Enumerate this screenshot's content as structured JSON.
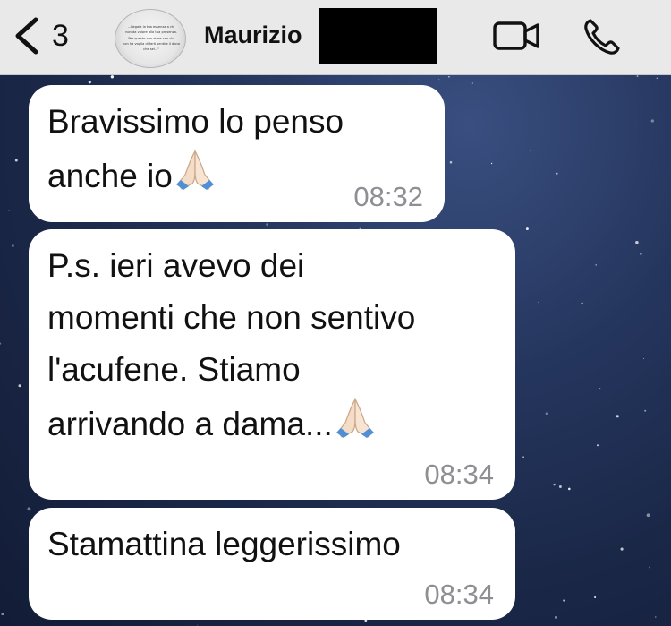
{
  "header": {
    "back_count": "3",
    "contact_name": "Maurizio",
    "avatar_caption": "...Regala la tua essenza a chi non da valore alla tua presenza. Per questo non stare con chi non ha voglia di farti sentire il dono che sei..."
  },
  "messages": [
    {
      "lines": [
        "Bravissimo lo penso",
        "anche io"
      ],
      "emoji": "folded-hands",
      "time": "08:32"
    },
    {
      "lines": [
        "P.s. ieri avevo dei",
        "momenti che non sentivo",
        "l'acufene. Stiamo",
        "arrivando a dama..."
      ],
      "emoji": "folded-hands",
      "time": "08:34"
    },
    {
      "lines": [
        "Stamattina leggerissimo"
      ],
      "emoji": "",
      "time": "08:34"
    }
  ],
  "colors": {
    "header_bg": "#e9e9e9",
    "bubble_bg": "#ffffff",
    "timestamp": "#8e8e93",
    "wallpaper": "#1f2d52"
  }
}
